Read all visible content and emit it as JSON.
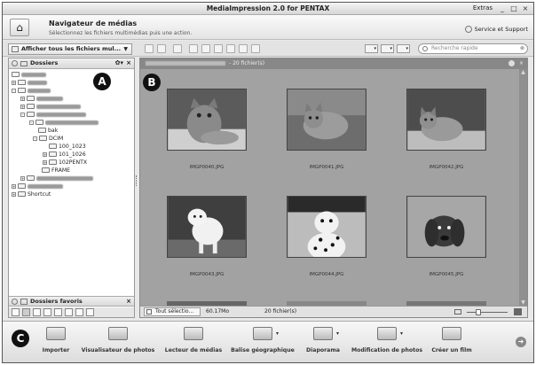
{
  "window": {
    "title": "MediaImpression 2.0 for PENTAX",
    "extras_menu": "Extras",
    "minimize": "_",
    "maximize": "□",
    "close": "×"
  },
  "header": {
    "nav_title": "Navigateur de médias",
    "nav_subtitle": "Sélectionnez les fichiers multimédias puis une action.",
    "service_link": "Service et Support"
  },
  "toolbar": {
    "show_all_label": "Afficher tous les fichiers mul...",
    "dropdown_glyph": "▼",
    "search_placeholder": "Recherche rapide",
    "search_clear": "⊗"
  },
  "folders_pane": {
    "title": "Dossiers",
    "gear_glyph": "✿▾",
    "close_glyph": "×",
    "tree": [
      {
        "label": "bak",
        "level": 3
      },
      {
        "label": "DCIM",
        "level": 3,
        "expanded": true
      },
      {
        "label": "100_1023",
        "level": 4
      },
      {
        "label": "101_1026",
        "level": 4
      },
      {
        "label": "102PENTX",
        "level": 4
      },
      {
        "label": "FRAME",
        "level": 3
      },
      {
        "label": "Shortcut",
        "level": 0
      }
    ]
  },
  "favorites_pane": {
    "title": "Dossiers favoris",
    "close_glyph": "×"
  },
  "content": {
    "path_suffix": "- 20 fichier(s)",
    "thumbnails": [
      {
        "name": "IMGP0040.JPG",
        "subject": "cat"
      },
      {
        "name": "IMGP0041.JPG",
        "subject": "cat"
      },
      {
        "name": "IMGP0042.JPG",
        "subject": "cat"
      },
      {
        "name": "IMGP0043.JPG",
        "subject": "dog"
      },
      {
        "name": "IMGP0044.JPG",
        "subject": "dog"
      },
      {
        "name": "IMGP0045.JPG",
        "subject": "dog"
      }
    ],
    "status": {
      "select_all": "Tout sélectio...",
      "size": "60.17Mo",
      "count": "20 fichier(s)"
    }
  },
  "badges": {
    "a": "A",
    "b": "B",
    "c": "C"
  },
  "actions": [
    {
      "label": "Importer",
      "icon": "import-icon"
    },
    {
      "label": "Visualisateur de photos",
      "icon": "photo-viewer-icon"
    },
    {
      "label": "Lecteur de médias",
      "icon": "media-player-icon"
    },
    {
      "label": "Balise géographique",
      "icon": "geotag-icon",
      "arrow": "▾"
    },
    {
      "label": "Diaporama",
      "icon": "slideshow-icon",
      "arrow": "▾"
    },
    {
      "label": "Modification de photos",
      "icon": "photo-edit-icon",
      "arrow": "▾"
    },
    {
      "label": "Créer un film",
      "icon": "movie-icon"
    }
  ],
  "next_glyph": "➜"
}
